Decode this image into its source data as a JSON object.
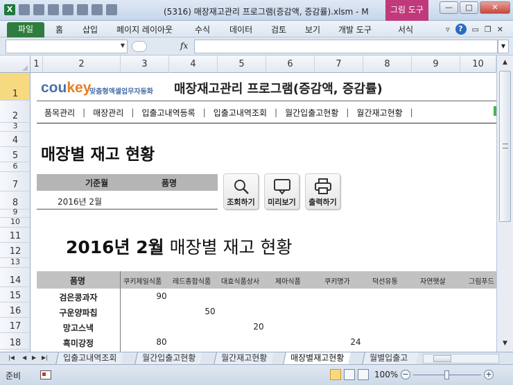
{
  "window": {
    "title": "(5316) 매장재고관리 프로그램(증감액, 증감률).xlsm - M",
    "context_tab": "그림 도구",
    "minimize": "—",
    "maximize": "□",
    "close": "✕"
  },
  "ribbon": {
    "file_tab": "파일",
    "tabs": [
      "홈",
      "삽입",
      "페이지 레이아웃",
      "수식",
      "데이터",
      "검토",
      "보기",
      "개발 도구",
      "서식"
    ],
    "help": "?"
  },
  "formula_bar": {
    "name_box": "",
    "fx": "fx",
    "value": ""
  },
  "columns": [
    "1",
    "2",
    "3",
    "4",
    "5",
    "6",
    "7",
    "8",
    "9",
    "10"
  ],
  "rows": [
    "1",
    "2",
    "3",
    "4",
    "5",
    "6",
    "7",
    "8",
    "9",
    "10",
    "11",
    "12",
    "13",
    "14",
    "15",
    "16",
    "17",
    "18"
  ],
  "sheet": {
    "logo_brand": "cou",
    "logo_key": "key",
    "logo_tagline": "맞춤형엑셀업무자동화",
    "app_title": "매장재고관리 프로그램(증감액, 증감률)",
    "nav": [
      "품목관리",
      "매장관리",
      "입출고내역등록",
      "입출고내역조회",
      "월간입출고현황",
      "월간재고현황"
    ],
    "nav_separator": "|",
    "section_title": "매장별 재고 현황",
    "filter": {
      "col1_header": "기준월",
      "col2_header": "품명",
      "col1_value": "2016년 2월",
      "col2_value": ""
    },
    "buttons": {
      "search": "조회하기",
      "preview": "미리보기",
      "print": "출력하기"
    },
    "report_title_bold": "2016년 2월",
    "report_title_rest": "매장별 재고 현황",
    "table": {
      "first_header": "품명",
      "stores": [
        "쿠키제일식품",
        "레드종합식품",
        "대효식품상사",
        "제아식품",
        "쿠키명가",
        "덕선유통",
        "자연햇살",
        "그림푸드"
      ],
      "rows": [
        {
          "name": "검은콩과자",
          "values": [
            "90",
            "",
            "",
            "",
            "",
            "",
            "",
            ""
          ]
        },
        {
          "name": "구운양파칩",
          "values": [
            "",
            "50",
            "",
            "",
            "",
            "",
            "",
            ""
          ]
        },
        {
          "name": "망고스낵",
          "values": [
            "",
            "",
            "20",
            "",
            "",
            "",
            "",
            ""
          ]
        },
        {
          "name": "흑미강정",
          "values": [
            "80",
            "",
            "",
            "",
            "24",
            "",
            "",
            ""
          ]
        }
      ]
    }
  },
  "sheet_tabs": [
    "입출고내역조회",
    "월간입출고현황",
    "월간재고현황",
    "매장별재고현황",
    "월별입출고"
  ],
  "active_sheet": "매장별재고현황",
  "status": {
    "ready": "준비",
    "zoom": "100%",
    "zoom_minus": "−",
    "zoom_plus": "+"
  },
  "colors": {
    "accent_excel": "#1f7a3d",
    "context_tab": "#c0397a",
    "logo_blue": "#4a6fa8",
    "logo_orange": "#e67e22",
    "header_gray": "#b5b5b5",
    "selected_row": "#f7d980"
  }
}
